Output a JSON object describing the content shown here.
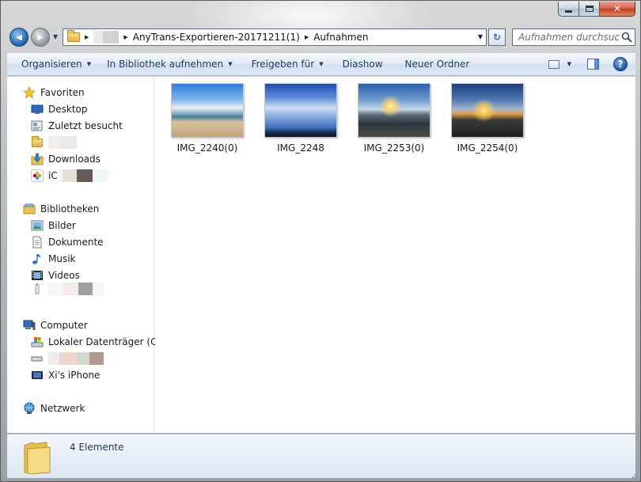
{
  "window": {
    "caption": {
      "close_glyph": "✕"
    }
  },
  "nav": {
    "back_glyph": "◀",
    "forward_glyph": "▶",
    "breadcrumbs": [
      "AnyTrans-Exportieren-20171211(1)",
      "Aufnahmen"
    ],
    "search_placeholder": "Aufnahmen durchsuchen",
    "refresh_glyph": "↻"
  },
  "commandbar": {
    "organize": "Organisieren",
    "add_to_library": "In Bibliothek aufnehmen",
    "share_with": "Freigeben für",
    "slideshow": "Diashow",
    "new_folder": "Neuer Ordner",
    "help_glyph": "?"
  },
  "sidebar": {
    "favorites_header": "Favoriten",
    "favorites": [
      {
        "label": "Desktop",
        "icon": "desktop-icon"
      },
      {
        "label": "Zuletzt besucht",
        "icon": "recent-places-icon"
      },
      {
        "label": "",
        "icon": "folder-icon"
      },
      {
        "label": "Downloads",
        "icon": "downloads-icon"
      },
      {
        "label": "iC",
        "icon": "photos-icon"
      }
    ],
    "libraries_header": "Bibliotheken",
    "libraries": [
      {
        "label": "Bilder",
        "icon": "pictures-icon"
      },
      {
        "label": "Dokumente",
        "icon": "documents-icon"
      },
      {
        "label": "Musik",
        "icon": "music-icon"
      },
      {
        "label": "Videos",
        "icon": "videos-icon"
      },
      {
        "label": "",
        "icon": "usb-icon"
      }
    ],
    "computer_header": "Computer",
    "computer": [
      {
        "label": "Lokaler Datenträger (C:)",
        "icon": "local-disk-icon"
      },
      {
        "label": "",
        "icon": "drive-icon"
      },
      {
        "label": "Xi's iPhone",
        "icon": "iphone-icon"
      }
    ],
    "network_header": "Netzwerk"
  },
  "files": [
    {
      "name": "IMG_2240(0)",
      "scene": "beach"
    },
    {
      "name": "IMG_2248",
      "scene": "sky"
    },
    {
      "name": "IMG_2253(0)",
      "scene": "sunset-people"
    },
    {
      "name": "IMG_2254(0)",
      "scene": "sunset"
    }
  ],
  "status": {
    "item_count": "4 Elemente"
  },
  "colors": {
    "accent": "#1e3958",
    "commandbar": "#dce7f5"
  }
}
